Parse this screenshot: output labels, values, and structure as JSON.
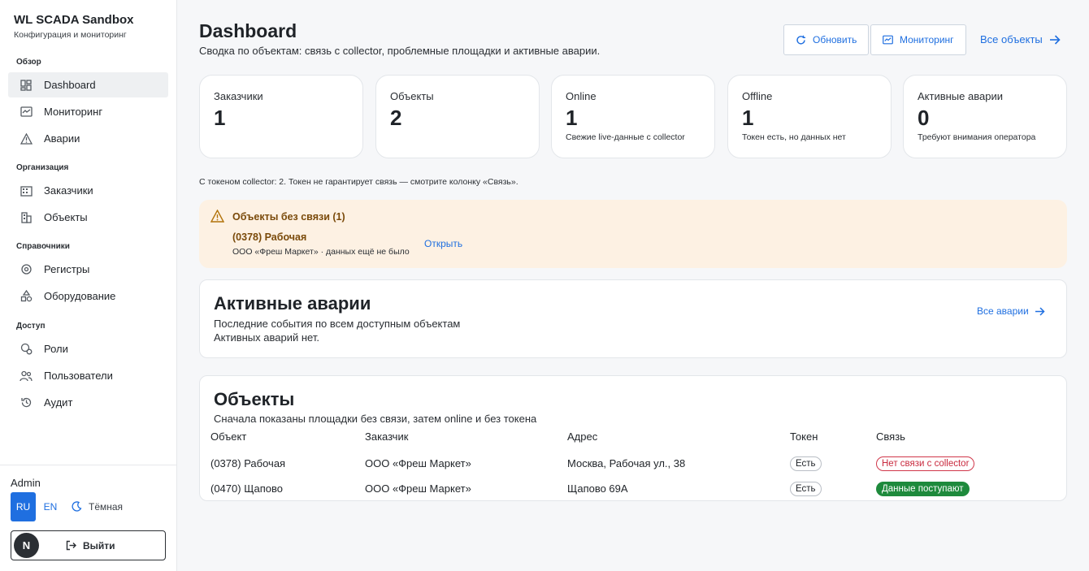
{
  "brand": {
    "title": "WL SCADA Sandbox",
    "subtitle": "Конфигурация и мониторинг"
  },
  "sidebar": {
    "sections": [
      {
        "label": "Обзор",
        "items": [
          {
            "label": "Dashboard",
            "icon": "dashboard-icon",
            "active": true
          },
          {
            "label": "Мониторинг",
            "icon": "monitoring-icon"
          },
          {
            "label": "Аварии",
            "icon": "warning-icon"
          }
        ]
      },
      {
        "label": "Организация",
        "items": [
          {
            "label": "Заказчики",
            "icon": "building-icon"
          },
          {
            "label": "Объекты",
            "icon": "buildings-icon"
          }
        ]
      },
      {
        "label": "Справочники",
        "items": [
          {
            "label": "Регистры",
            "icon": "registers-icon"
          },
          {
            "label": "Оборудование",
            "icon": "equipment-icon"
          }
        ]
      },
      {
        "label": "Доступ",
        "items": [
          {
            "label": "Роли",
            "icon": "roles-icon"
          },
          {
            "label": "Пользователи",
            "icon": "users-icon"
          },
          {
            "label": "Аудит",
            "icon": "history-icon"
          }
        ]
      }
    ],
    "user": "Admin",
    "lang_ru": "RU",
    "lang_en": "EN",
    "theme": "Тёмная",
    "avatar": "N",
    "logout": "Выйти"
  },
  "header": {
    "title": "Dashboard",
    "subtitle": "Сводка по объектам: связь с collector, проблемные площадки и активные аварии.",
    "refresh": "Обновить",
    "monitoring": "Мониторинг",
    "all_objects": "Все объекты"
  },
  "stats": [
    {
      "title": "Заказчики",
      "value": "1",
      "sub": ""
    },
    {
      "title": "Объекты",
      "value": "2",
      "sub": ""
    },
    {
      "title": "Online",
      "value": "1",
      "sub": "Свежие live-данные с collector"
    },
    {
      "title": "Offline",
      "value": "1",
      "sub": "Токен есть, но данных нет"
    },
    {
      "title": "Активные аварии",
      "value": "0",
      "sub": "Требуют внимания оператора"
    }
  ],
  "token_note": "С токеном collector: 2. Токен не гарантирует связь — смотрите колонку «Связь».",
  "warning": {
    "title": "Объекты без связи (1)",
    "object": "(0378) Рабочая",
    "meta": "ООО «Фреш Маркет» · данных ещё не было",
    "open": "Открыть",
    "color": "#fdf1e3"
  },
  "alarms": {
    "title": "Активные аварии",
    "subtitle": "Последние события по всем доступным объектам",
    "empty": "Активных аварий нет.",
    "link": "Все аварии"
  },
  "objects": {
    "title": "Объекты",
    "subtitle": "Сначала показаны площадки без связи, затем online и без токена",
    "columns": [
      "Объект",
      "Заказчик",
      "Адрес",
      "Токен",
      "Связь"
    ],
    "rows": [
      {
        "object": "(0378) Рабочая",
        "customer": "ООО «Фреш Маркет»",
        "address": "Москва, Рабочая ул., 38",
        "token": "Есть",
        "link": "Нет связи с collector",
        "status": "offline"
      },
      {
        "object": "(0470) Щапово",
        "customer": "ООО «Фреш Маркет»",
        "address": "Щапово 69А",
        "token": "Есть",
        "link": "Данные поступают",
        "status": "online"
      }
    ]
  },
  "colors": {
    "accent": "#1f6fe0",
    "online": "#1e8a3c",
    "offline": "#c92a3e"
  }
}
